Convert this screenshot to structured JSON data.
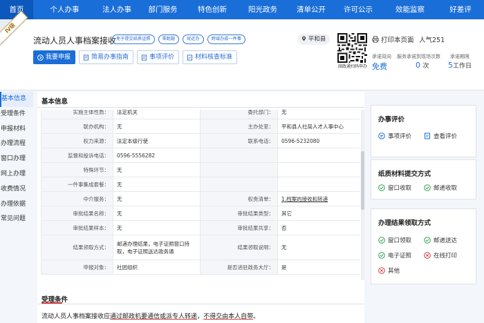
{
  "nav": {
    "items": [
      "首页",
      "个人办事",
      "法人办事",
      "部门服务",
      "特色创新",
      "阳光政务",
      "清单公开",
      "许可公示",
      "效能监察",
      "好差评"
    ],
    "active_index": 0
  },
  "header": {
    "level_badge": "Ⅳ级",
    "title": "流动人员人事档案接收",
    "tags": [
      "免于提交纸质证照",
      "零跑腿",
      "就近办",
      "跨域办成一件事"
    ],
    "buttons": [
      "我要申报",
      "简易办事指南",
      "事项评价",
      "材料核查标准"
    ],
    "location": "平和县",
    "qr_caption": "闽政通扫码申办",
    "print_label": "打印本页面",
    "popularity": "人气251",
    "stats": [
      {
        "label": "承诺双向",
        "value": "免费",
        "unit": ""
      },
      {
        "label": "服务承诺到现场次数",
        "value": "0",
        "unit": "次"
      },
      {
        "label": "承诺期限",
        "value": "5",
        "unit": "工作日"
      }
    ]
  },
  "sidebar": {
    "items": [
      "基本信息",
      "受理条件",
      "申报材料",
      "办理流程",
      "窗口办理",
      "网上办理",
      "收费情况",
      "办理依据",
      "常见问题"
    ],
    "active_index": 0
  },
  "main": {
    "title": "基本信息",
    "rows": [
      [
        "实施主体性质：",
        "法定机关",
        "委托部门：",
        "无"
      ],
      [
        "联办机构：",
        "无",
        "主办处室：",
        "平和县人社局人才人事中心"
      ],
      [
        "权力来源：",
        "法定本级行使",
        "联系电话：",
        "0596-5232080"
      ],
      [
        "监督和投诉电话：",
        "0596-5556282",
        "",
        ""
      ],
      [
        "特殊环节：",
        "无",
        "",
        ""
      ],
      [
        "一件事集成套餐：",
        "无",
        "",
        ""
      ],
      [
        "中介服务：",
        "无",
        "权责清单：",
        "1.档案的接收和转递"
      ],
      [
        "审批结果名称：",
        "无",
        "审批结果类型：",
        "其它"
      ],
      [
        "审批结果样本：",
        "无",
        "审批结果共享：",
        "否"
      ],
      [
        "结果领取方式：",
        "邮递办理结果，电子证照窗口持取，电子证照送达政务通",
        "结果领取说明：",
        "无"
      ],
      [
        "申报对象：",
        "社团组织",
        "是否进驻政务大厅：",
        "是"
      ]
    ],
    "section2_title": "受理条件",
    "condition_text_parts": [
      "流动人员人事档案接收应",
      "通过邮政机要通信",
      "或",
      "派专人转递",
      "不得交由本人自带",
      "。"
    ]
  },
  "cards": {
    "evaluate": {
      "title": "办事评价",
      "items": [
        "事项评价",
        "查看评价"
      ]
    },
    "materials": {
      "title": "纸质材料提交方式",
      "items": [
        "窗口收取",
        "邮递收取"
      ]
    },
    "results": {
      "title": "办理结果领取方式",
      "items": [
        "窗口领取",
        "邮递送达",
        "电子证照",
        "在线打印",
        "其他"
      ],
      "states": [
        "ok",
        "ok",
        "ok",
        "no",
        "no"
      ]
    }
  },
  "colors": {
    "primary": "#1a6ed8",
    "nav_active": "#0d58bd",
    "ok": "#2ea44f",
    "no": "#d23b3b"
  }
}
